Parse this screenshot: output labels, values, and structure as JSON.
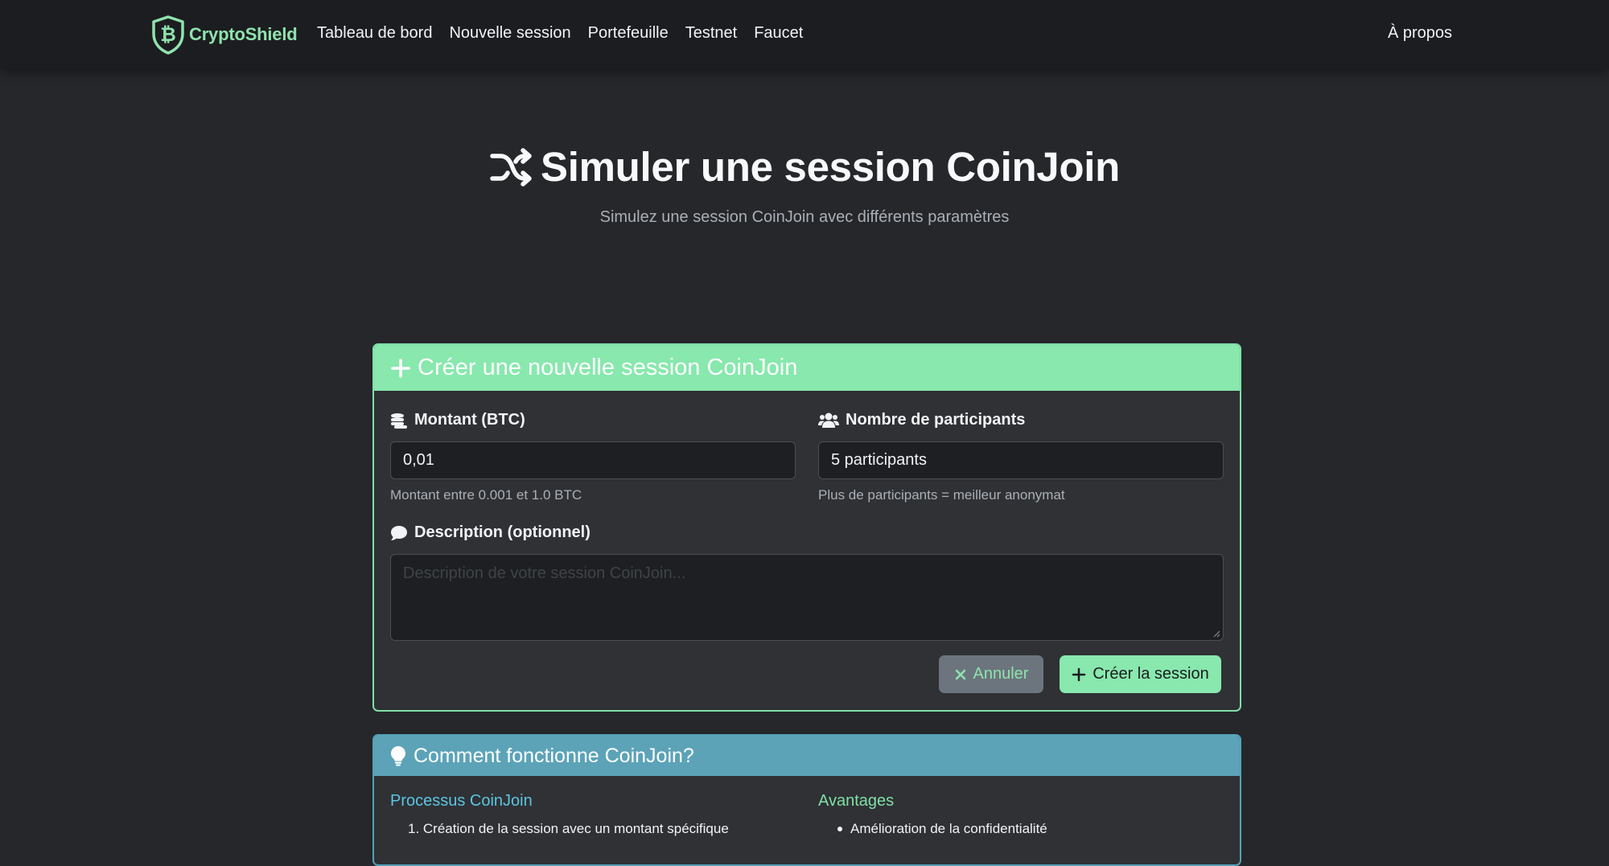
{
  "navbar": {
    "brand": "CryptoShield",
    "links": [
      "Tableau de bord",
      "Nouvelle session",
      "Portefeuille",
      "Testnet",
      "Faucet"
    ],
    "right_link": "À propos"
  },
  "header": {
    "title": "Simuler une session CoinJoin",
    "subtitle": "Simulez une session CoinJoin avec différents paramètres"
  },
  "create_card": {
    "title": "Créer une nouvelle session CoinJoin",
    "amount": {
      "label": "Montant (BTC)",
      "value": "0,01",
      "helper": "Montant entre 0.001 et 1.0 BTC"
    },
    "participants": {
      "label": "Nombre de participants",
      "value": "5 participants",
      "helper": "Plus de participants = meilleur anonymat"
    },
    "description": {
      "label": "Description (optionnel)",
      "placeholder": "Description de votre session CoinJoin..."
    },
    "cancel_label": "Annuler",
    "submit_label": "Créer la session"
  },
  "info_card": {
    "title": "Comment fonctionne CoinJoin?",
    "process": {
      "heading": "Processus CoinJoin",
      "items": [
        "1. Création de la session avec un montant spécifique"
      ]
    },
    "benefits": {
      "heading": "Avantages",
      "items": [
        "Amélioration de la confidentialité"
      ]
    }
  },
  "colors": {
    "accent_green": "#88e8ad",
    "accent_blue": "#5ca3b8",
    "process_heading": "#5cc5e0",
    "benefits_heading": "#7fe0a5",
    "background": "#25272b"
  },
  "icons": {
    "brand": "bitcoin-shield-icon",
    "title": "shuffle-icon",
    "create": "plus-icon",
    "amount": "coins-icon",
    "participants": "users-icon",
    "description": "comment-icon",
    "cancel": "close-icon",
    "info": "lightbulb-icon"
  }
}
